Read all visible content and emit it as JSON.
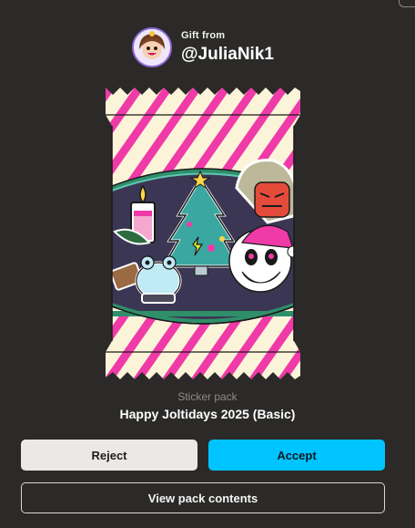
{
  "gift": {
    "label": "Gift from",
    "username": "@JuliaNik1"
  },
  "pack": {
    "type": "Sticker pack",
    "name": "Happy Joltidays 2025 (Basic)"
  },
  "buttons": {
    "reject": "Reject",
    "accept": "Accept",
    "view": "View pack contents"
  },
  "colors": {
    "background": "#2b2a28",
    "accent": "#00c4ff",
    "reject_bg": "#ebe8e5",
    "stripe": "#f03aa8",
    "wrapper_cream": "#fbf4d9",
    "band_green": "#2f8f6a"
  }
}
